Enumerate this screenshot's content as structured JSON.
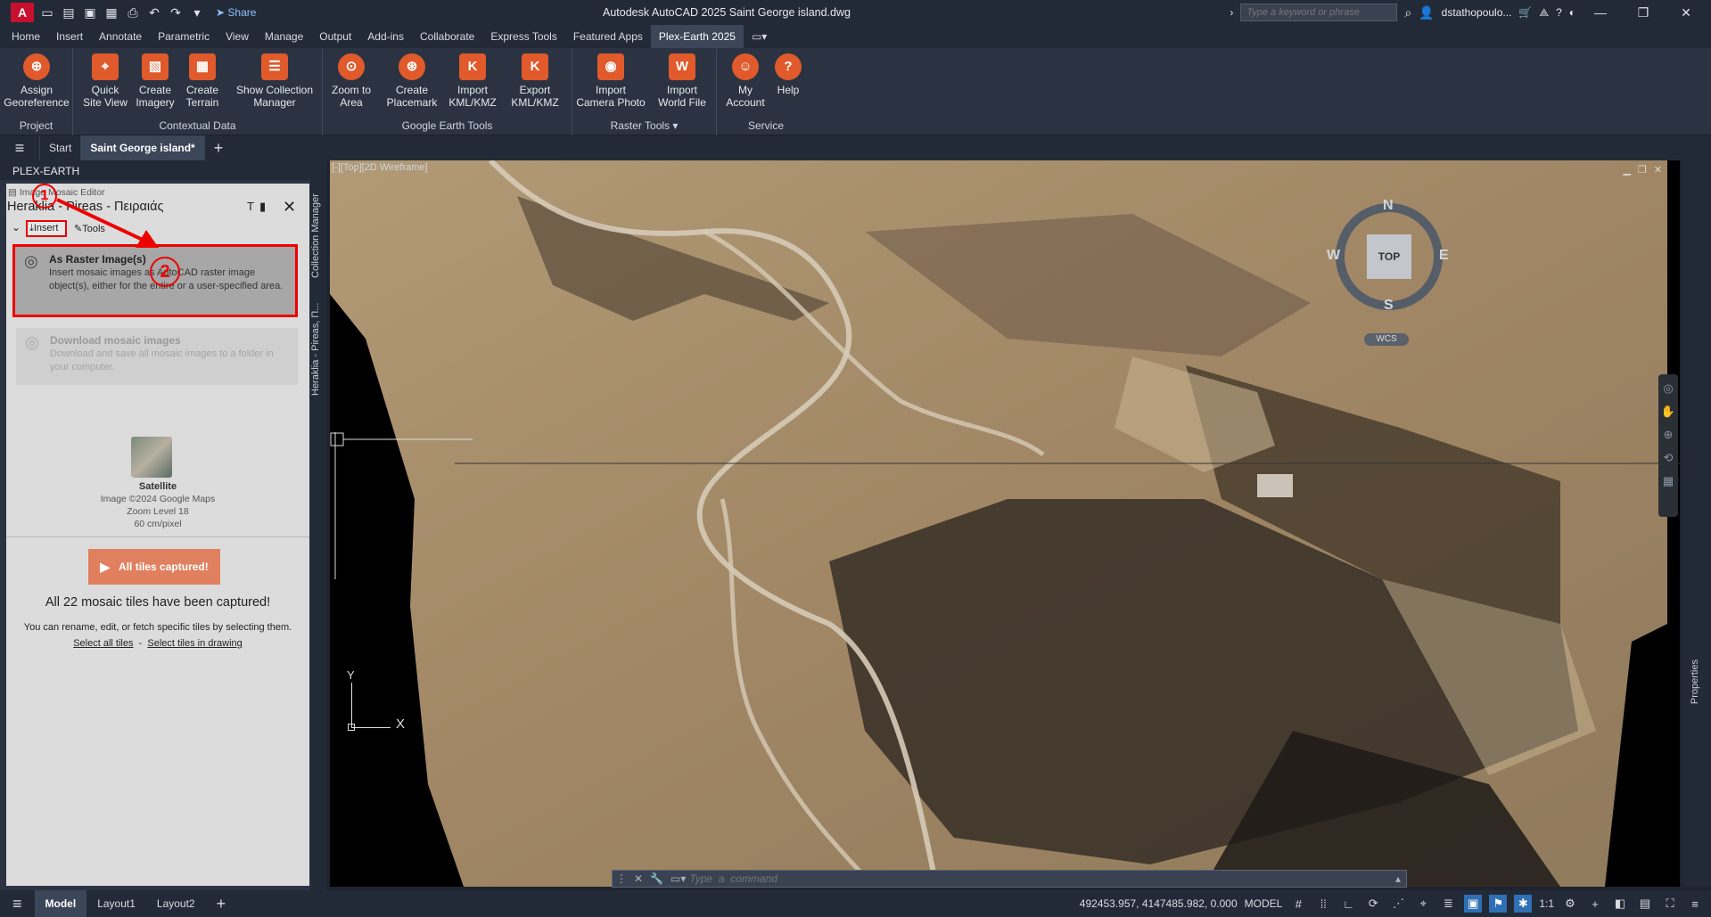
{
  "app": {
    "logo": "A",
    "share_label": "Share",
    "title": "Autodesk AutoCAD 2025    Saint George island.dwg",
    "search_placeholder": "Type a keyword or phrase",
    "user": "dstathopoulo..."
  },
  "menu": {
    "tabs": [
      "Home",
      "Insert",
      "Annotate",
      "Parametric",
      "View",
      "Manage",
      "Output",
      "Add-ins",
      "Collaborate",
      "Express Tools",
      "Featured Apps",
      "Plex-Earth 2025"
    ],
    "active": "Plex-Earth 2025"
  },
  "ribbon": {
    "panels": [
      {
        "title": "Project",
        "buttons": [
          {
            "line1": "Assign",
            "line2": "Georeference",
            "icon": "crosshair-icon"
          }
        ]
      },
      {
        "title": "Contextual Data",
        "buttons": [
          {
            "line1": "Quick",
            "line2": "Site View",
            "icon": "map-pin-icon"
          },
          {
            "line1": "Create",
            "line2": "Imagery",
            "icon": "image-add-icon"
          },
          {
            "line1": "Create",
            "line2": "Terrain",
            "icon": "grid-add-icon"
          },
          {
            "line1": "Show Collection",
            "line2": "Manager",
            "icon": "collection-icon"
          }
        ]
      },
      {
        "title": "Google Earth Tools",
        "buttons": [
          {
            "line1": "Zoom to",
            "line2": "Area",
            "icon": "zoom-area-icon"
          },
          {
            "line1": "Create",
            "line2": "Placemark",
            "icon": "placemark-icon"
          },
          {
            "line1": "Import",
            "line2": "KML/KMZ",
            "icon": "kml-import-icon"
          },
          {
            "line1": "Export",
            "line2": "KML/KMZ",
            "icon": "kml-export-icon"
          }
        ]
      },
      {
        "title": "Raster Tools",
        "buttons": [
          {
            "line1": "Import",
            "line2": "Camera Photo",
            "icon": "camera-icon"
          },
          {
            "line1": "Import",
            "line2": "World File",
            "icon": "world-file-icon"
          }
        ]
      },
      {
        "title": "Service",
        "buttons": [
          {
            "line1": "My",
            "line2": "Account",
            "icon": "account-icon"
          },
          {
            "line1": "Help",
            "line2": "",
            "icon": "help-icon"
          }
        ]
      }
    ]
  },
  "file_tabs": {
    "start": "Start",
    "active": "Saint George island*",
    "add": "+"
  },
  "left_panel": {
    "header": "PLEX-EARTH",
    "editor_label": "Image Mosaic Editor",
    "mosaic_title": "Heraklia - Pireas - Πειραιάς",
    "tab_insert": "Insert",
    "tab_tools": "Tools",
    "card1": {
      "title": "As Raster Image(s)",
      "desc": "Insert mosaic images as AutoCAD raster image object(s), either for the entire or a user-specified area."
    },
    "card2": {
      "title": "Download mosaic images",
      "desc": "Download and save all mosaic images to a folder in your computer."
    },
    "provider": {
      "name": "Satellite",
      "copyright": "Image ©2024 Google Maps",
      "zoom": "Zoom Level 18",
      "res": "60 cm/pixel"
    },
    "captured_button": "All tiles captured!",
    "summary": "All 22 mosaic tiles have been captured!",
    "hint": "You can rename, edit, or fetch specific tiles by selecting them.",
    "link1": "Select all tiles",
    "link_sep": "-",
    "link2": "Select tiles in drawing",
    "annot1": "1",
    "annot2": "2"
  },
  "side_tabs": {
    "collection_manager": "Collection Manager",
    "heraklia": "Heraklia - Pireas, П...",
    "properties": "Properties"
  },
  "viewport": {
    "label": "[-][Top][2D Wireframe]",
    "compass": {
      "n": "N",
      "s": "S",
      "e": "E",
      "w": "W",
      "top": "TOP"
    },
    "wcs": "WCS",
    "ucs_y": "Y",
    "ucs_x": "X"
  },
  "command_line": {
    "placeholder": "Type  a  command"
  },
  "status": {
    "tabs": [
      "Model",
      "Layout1",
      "Layout2"
    ],
    "active": "Model",
    "coords": "492453.957, 4147485.982, 0.000",
    "model_label": "MODEL",
    "scale": "1:1"
  }
}
